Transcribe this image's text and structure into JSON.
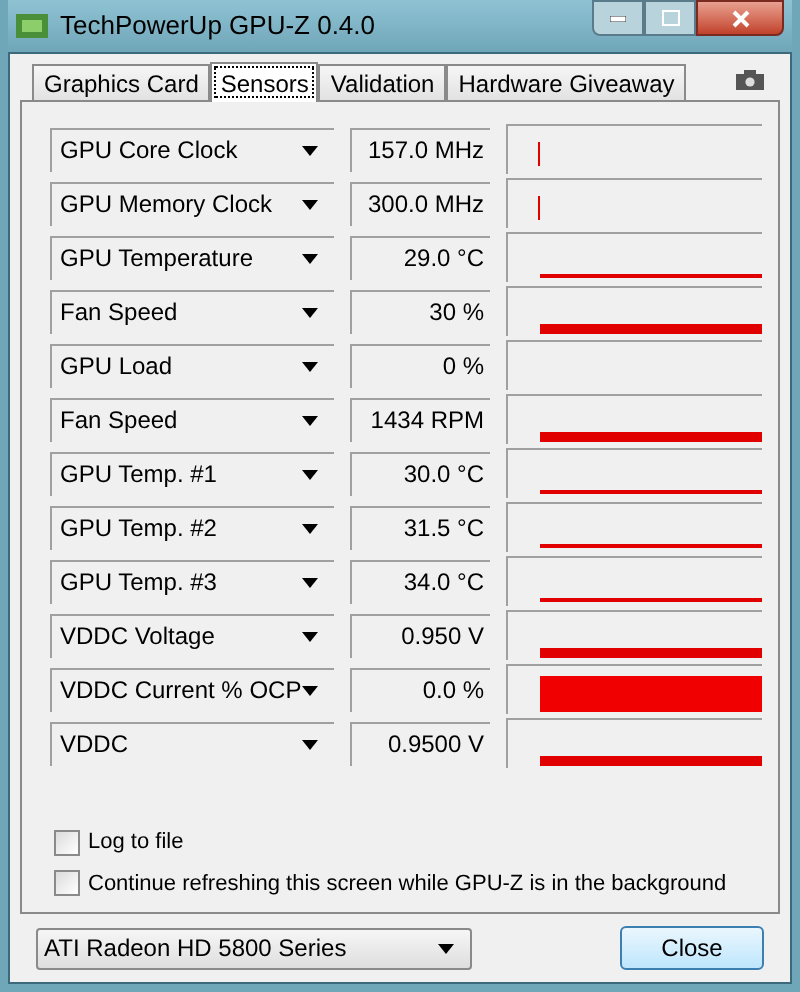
{
  "window": {
    "title": "TechPowerUp GPU-Z 0.4.0"
  },
  "tabs": [
    {
      "label": "Graphics Card",
      "selected": false
    },
    {
      "label": "Sensors",
      "selected": true
    },
    {
      "label": "Validation",
      "selected": false
    },
    {
      "label": "Hardware Giveaway",
      "selected": false
    }
  ],
  "sensors": [
    {
      "name": "GPU Core Clock",
      "reading": "157.0 MHz",
      "kind": "spike"
    },
    {
      "name": "GPU Memory Clock",
      "reading": "300.0 MHz",
      "kind": "spike"
    },
    {
      "name": "GPU Temperature",
      "reading": "29.0 °C",
      "kind": "line"
    },
    {
      "name": "Fan Speed",
      "reading": "30 %",
      "kind": "bar"
    },
    {
      "name": "GPU Load",
      "reading": "0 %",
      "kind": "empty"
    },
    {
      "name": "Fan Speed",
      "reading": "1434 RPM",
      "kind": "bar"
    },
    {
      "name": "GPU Temp. #1",
      "reading": "30.0 °C",
      "kind": "line"
    },
    {
      "name": "GPU Temp. #2",
      "reading": "31.5 °C",
      "kind": "line"
    },
    {
      "name": "GPU Temp. #3",
      "reading": "34.0 °C",
      "kind": "line"
    },
    {
      "name": "VDDC Voltage",
      "reading": "0.950 V",
      "kind": "bar"
    },
    {
      "name": "VDDC Current % OCP",
      "reading": "0.0 %",
      "kind": "block"
    },
    {
      "name": "VDDC",
      "reading": "0.9500 V",
      "kind": "bar"
    }
  ],
  "options": [
    {
      "label": "Log to file",
      "checked": false
    },
    {
      "label": "Continue refreshing this screen while GPU-Z is in the background",
      "checked": false
    }
  ],
  "device_select": {
    "value": "ATI Radeon HD 5800 Series"
  },
  "close_button": {
    "label": "Close"
  }
}
